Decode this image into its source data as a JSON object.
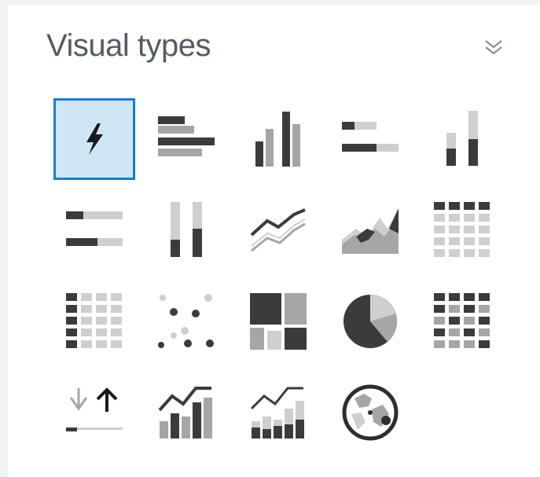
{
  "panel": {
    "title": "Visual types",
    "collapse_icon": "chevron-double-down-icon"
  },
  "visual_types": [
    {
      "icon": "autograph-icon",
      "selected": true
    },
    {
      "icon": "horizontal-bar-chart-icon"
    },
    {
      "icon": "vertical-bar-chart-icon"
    },
    {
      "icon": "horizontal-stacked-bar-chart-icon"
    },
    {
      "icon": "vertical-stacked-bar-chart-icon"
    },
    {
      "icon": "horizontal-stacked-100-bar-chart-icon"
    },
    {
      "icon": "vertical-stacked-100-bar-chart-icon"
    },
    {
      "icon": "line-chart-icon"
    },
    {
      "icon": "area-line-chart-icon"
    },
    {
      "icon": "pivot-table-icon"
    },
    {
      "icon": "table-icon"
    },
    {
      "icon": "scatter-plot-icon"
    },
    {
      "icon": "tree-map-icon"
    },
    {
      "icon": "pie-chart-icon"
    },
    {
      "icon": "heat-map-icon"
    },
    {
      "icon": "kpi-icon"
    },
    {
      "icon": "combo-bar-line-chart-icon"
    },
    {
      "icon": "combo-stacked-bar-line-chart-icon"
    },
    {
      "icon": "geospatial-map-icon"
    }
  ],
  "colors": {
    "dark": "#3b3b3b",
    "mid": "#a6a6a6",
    "light": "#cfcfcf",
    "selected_bg": "#cfe6f5",
    "selected_border": "#1a7fc9"
  }
}
